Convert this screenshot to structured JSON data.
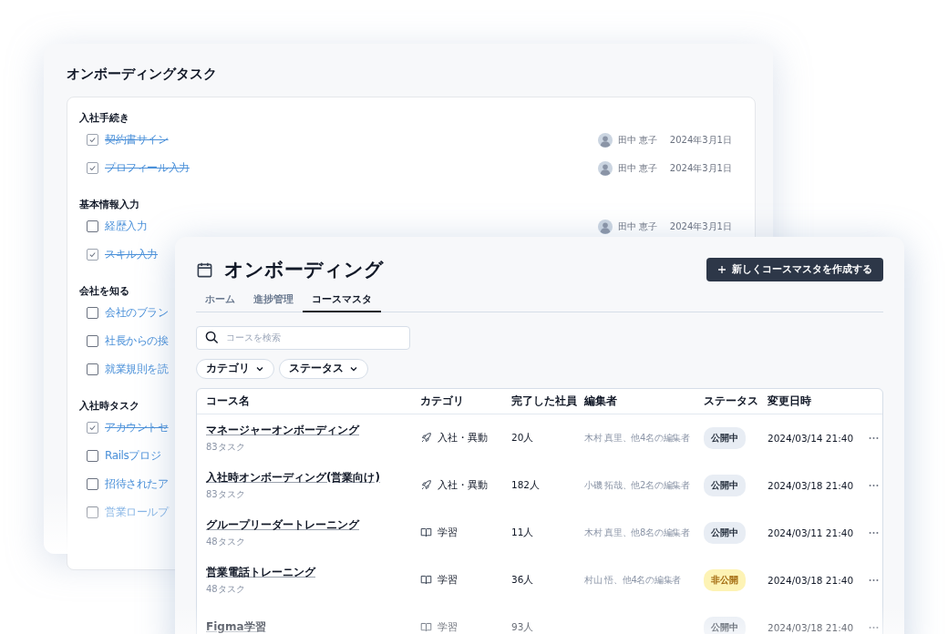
{
  "task_window": {
    "title": "オンボーディングタスク",
    "groups": [
      {
        "title": "入社手続き",
        "items": [
          {
            "label": "契約書サイン",
            "checked": true,
            "assignee": "田中 恵子",
            "date": "2024年3月1日"
          },
          {
            "label": "プロフィール入力",
            "checked": true,
            "assignee": "田中 恵子",
            "date": "2024年3月1日"
          }
        ]
      },
      {
        "title": "基本情報入力",
        "items": [
          {
            "label": "経歴入力",
            "checked": false,
            "assignee": "田中 恵子",
            "date": "2024年3月1日"
          },
          {
            "label": "スキル入力",
            "checked": true
          }
        ]
      },
      {
        "title": "会社を知る",
        "items": [
          {
            "label": "会社のブラン",
            "checked": false
          },
          {
            "label": "社長からの挨",
            "checked": false
          },
          {
            "label": "就業規則を読",
            "checked": false
          }
        ]
      },
      {
        "title": "入社時タスク",
        "items": [
          {
            "label": "アカウントセ",
            "checked": true
          },
          {
            "label": "Railsプロジ",
            "checked": false
          },
          {
            "label": "招待されたア",
            "checked": false
          },
          {
            "label": "営業ロールプ",
            "checked": false
          }
        ]
      }
    ]
  },
  "course_window": {
    "title": "オンボーディング",
    "create_button": "新しくコースマスタを作成する",
    "tabs": [
      {
        "label": "ホーム",
        "selected": false
      },
      {
        "label": "進捗管理",
        "selected": false
      },
      {
        "label": "コースマスタ",
        "selected": true
      }
    ],
    "search": {
      "placeholder": "コースを検索"
    },
    "filters": [
      "カテゴリ",
      "ステータス"
    ],
    "table": {
      "columns": [
        "コース名",
        "カテゴリ",
        "完了した社員",
        "編集者",
        "ステータス",
        "変更日時"
      ],
      "rows": [
        {
          "name": "マネージャーオンボーディング",
          "tasks": "83タスク",
          "category": {
            "kind": "rocket",
            "label": "入社・異動"
          },
          "completed": "20人",
          "editors": "木村 真里、他4名の編集者",
          "status": {
            "kind": "published",
            "label": "公開中"
          },
          "updated": "2024/03/14 21:40"
        },
        {
          "name": "入社時オンボーディング(営業向け)",
          "tasks": "83タスク",
          "category": {
            "kind": "rocket",
            "label": "入社・異動"
          },
          "completed": "182人",
          "editors": "小磯 拓哉、他2名の編集者",
          "status": {
            "kind": "published",
            "label": "公開中"
          },
          "updated": "2024/03/18 21:40"
        },
        {
          "name": "グループリーダートレーニング",
          "tasks": "48タスク",
          "category": {
            "kind": "book",
            "label": "学習"
          },
          "completed": "11人",
          "editors": "木村 真里、他8名の編集者",
          "status": {
            "kind": "published",
            "label": "公開中"
          },
          "updated": "2024/03/11 21:40"
        },
        {
          "name": "営業電話トレーニング",
          "tasks": "48タスク",
          "category": {
            "kind": "book",
            "label": "学習"
          },
          "completed": "36人",
          "editors": "村山 悟、他4名の編集者",
          "status": {
            "kind": "private",
            "label": "非公開"
          },
          "updated": "2024/03/18 21:40"
        },
        {
          "name": "Figma学習",
          "category": {
            "kind": "book",
            "label": "学習"
          },
          "completed": "93人",
          "status": {
            "kind": "published",
            "label": "公開中"
          },
          "updated": "2024/03/18 21:40"
        }
      ]
    }
  }
}
